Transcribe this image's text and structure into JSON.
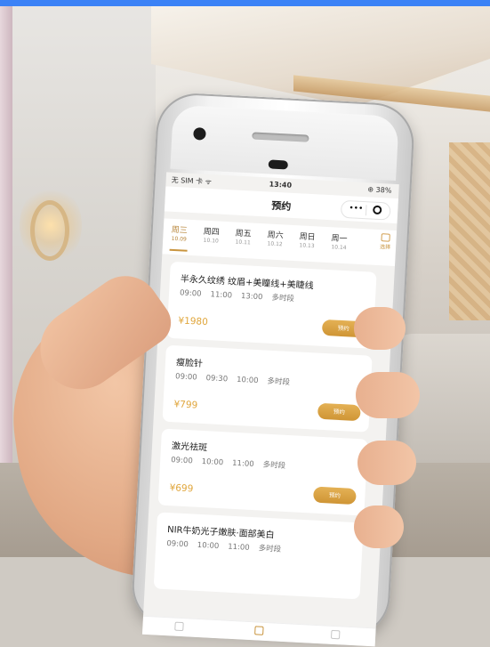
{
  "colors": {
    "accent": "#c9953f",
    "price": "#e0a63c",
    "topbar": "#3b82f6"
  },
  "status": {
    "carrier": "无 SIM 卡 ᯤ",
    "time": "13:40",
    "battery": "⊕ 38%"
  },
  "nav": {
    "title": "预约",
    "menu_icon": "•••",
    "target_icon": "target-icon"
  },
  "days": [
    {
      "label": "周三",
      "date": "10.09",
      "active": true
    },
    {
      "label": "周四",
      "date": "10.10"
    },
    {
      "label": "周五",
      "date": "10.11"
    },
    {
      "label": "周六",
      "date": "10.12"
    },
    {
      "label": "周日",
      "date": "10.13"
    },
    {
      "label": "周一",
      "date": "10.14"
    }
  ],
  "calendar_label": "选择",
  "cards": [
    {
      "name": "半永久纹绣 纹眉+美瞳线+美睫线",
      "times": [
        "09:00",
        "11:00",
        "13:00",
        "多时段"
      ],
      "price": "¥1980",
      "button": "预约"
    },
    {
      "name": "瘦脸针",
      "times": [
        "09:00",
        "09:30",
        "10:00",
        "多时段"
      ],
      "price": "¥799",
      "button": "预约"
    },
    {
      "name": "激光祛斑",
      "times": [
        "09:00",
        "10:00",
        "11:00",
        "多时段"
      ],
      "price": "¥699",
      "button": "预约"
    },
    {
      "name": "NIR牛奶光子嫩肤·面部美白",
      "times": [
        "09:00",
        "10:00",
        "11:00",
        "多时段"
      ]
    }
  ]
}
